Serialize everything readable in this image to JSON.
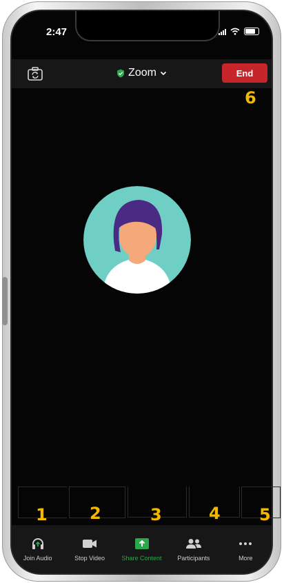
{
  "status_bar": {
    "time": "2:47"
  },
  "top_bar": {
    "title": "Zoom",
    "end_label": "End"
  },
  "annotations": {
    "n1": "1",
    "n2": "2",
    "n3": "3",
    "n4": "4",
    "n5": "5",
    "n6": "6"
  },
  "toolbar": {
    "items": [
      {
        "label": "Join Audio",
        "icon": "headphones-icon"
      },
      {
        "label": "Stop Video",
        "icon": "video-camera-icon"
      },
      {
        "label": "Share Content",
        "icon": "share-arrow-icon"
      },
      {
        "label": "Participants",
        "icon": "participants-icon"
      },
      {
        "label": "More",
        "icon": "more-dots-icon"
      }
    ]
  },
  "colors": {
    "end_red": "#c6252c",
    "share_green": "#2aa84a",
    "annotation_yellow": "#f5b800",
    "avatar_bg": "#6fcfc4",
    "hair": "#4b2a84"
  }
}
